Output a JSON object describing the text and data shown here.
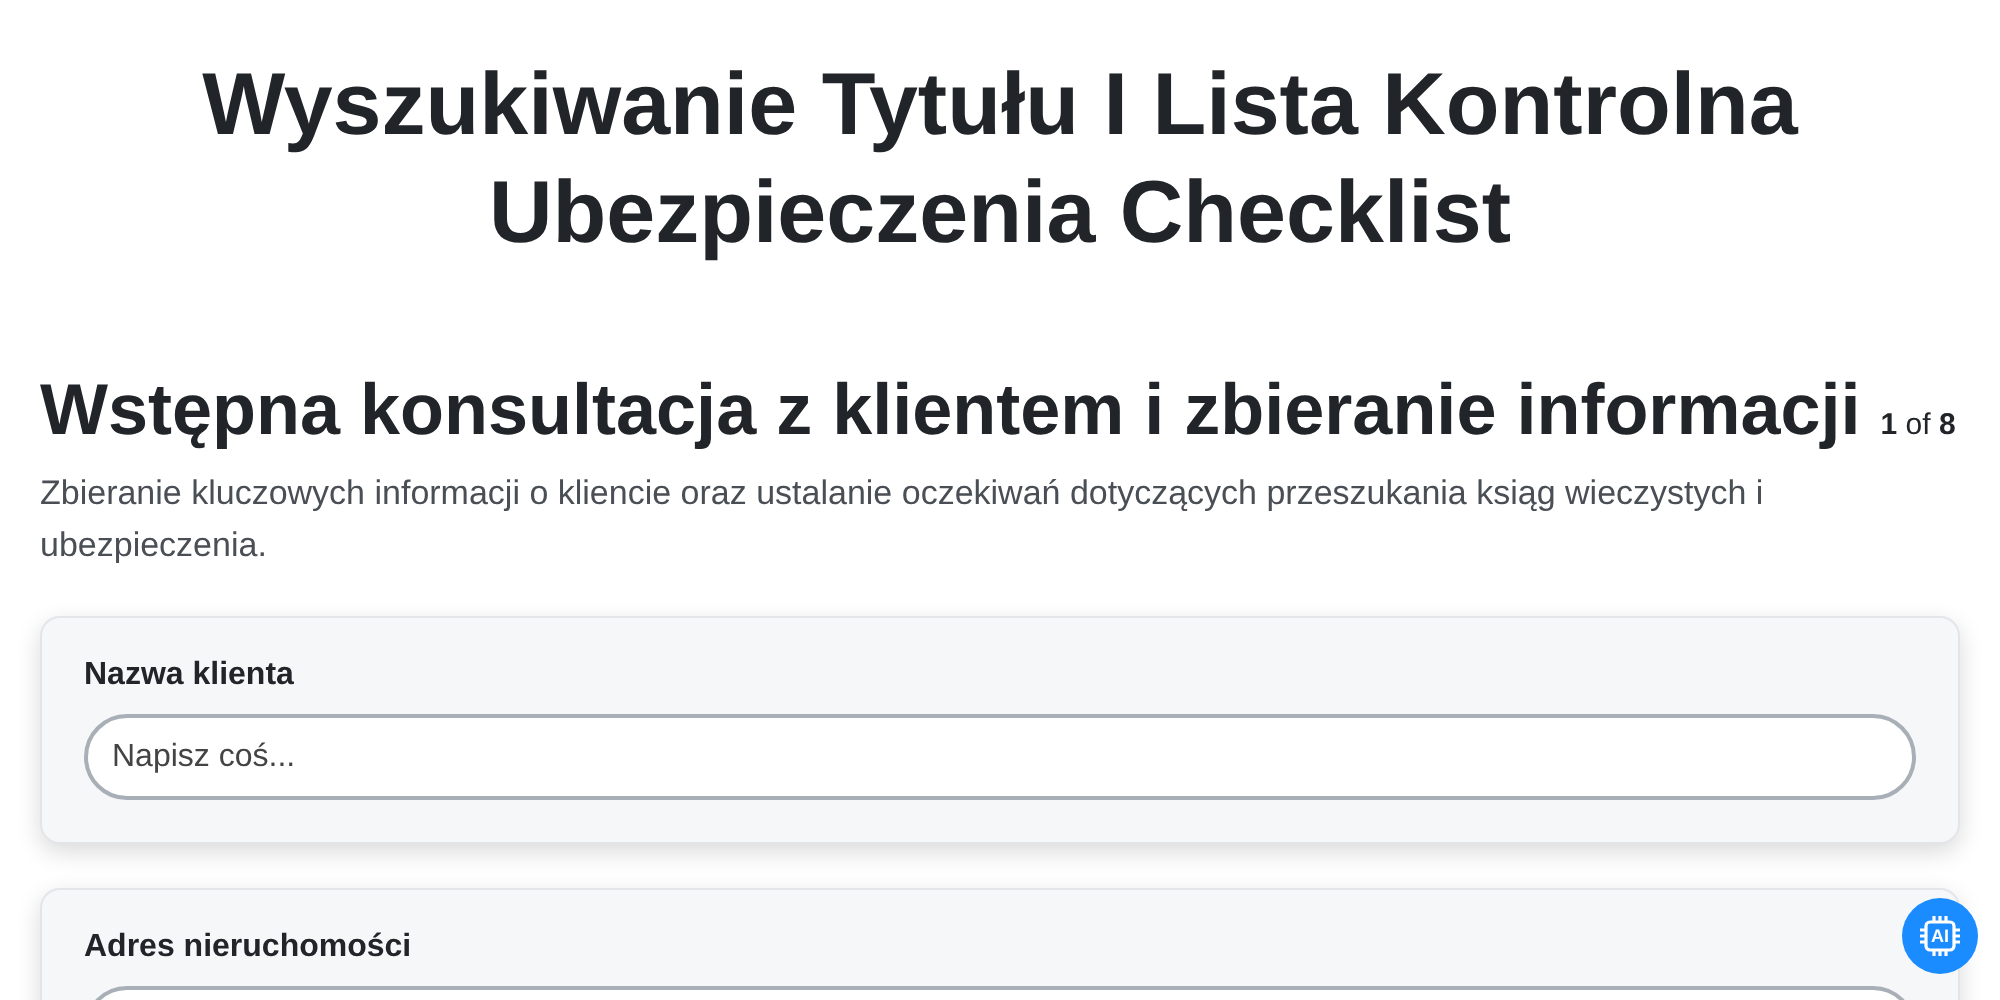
{
  "title": "Wyszukiwanie Tytułu I Lista Kontrolna Ubezpieczenia Checklist",
  "section": {
    "heading": "Wstępna konsultacja z klientem i zbieranie informacji",
    "progress": "**1** of **8**",
    "description": "Zbieranie kluczowych informacji o kliencie oraz ustalanie oczekiwań dotyczących przeszukania ksiąg wieczystych i ubezpieczenia."
  },
  "fields": [
    {
      "label": "Nazwa klienta",
      "placeholder": "Napisz coś..."
    },
    {
      "label": "Adres nieruchomości"
    }
  ],
  "assistant_button": {
    "label": "AI"
  }
}
